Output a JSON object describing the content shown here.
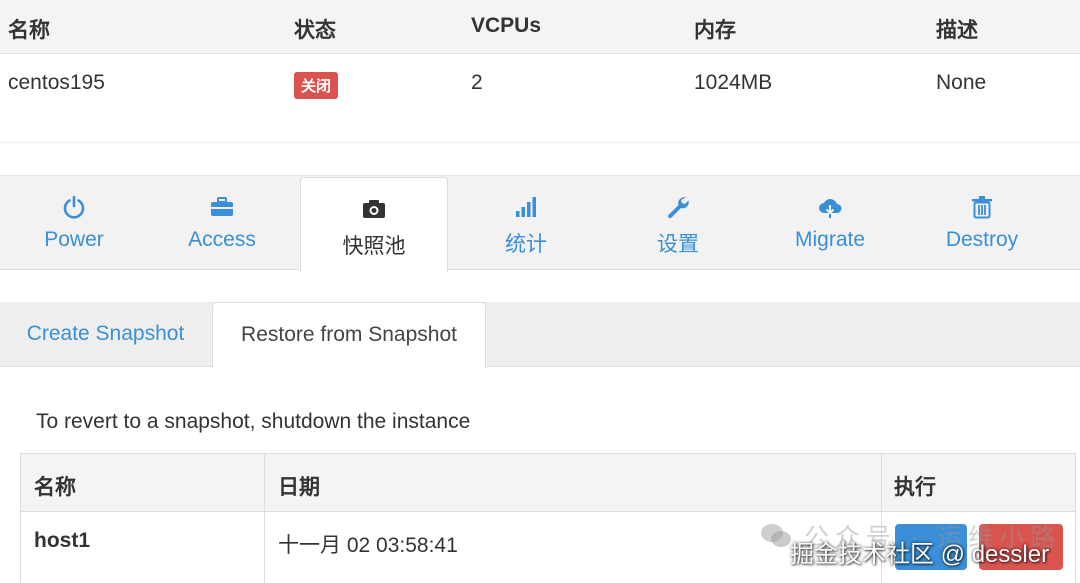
{
  "instance_table": {
    "headers": [
      "名称",
      "状态",
      "VCPUs",
      "内存",
      "描述"
    ],
    "row": {
      "name": "centos195",
      "status": "关闭",
      "vcpus": "2",
      "memory": "1024MB",
      "description": "None"
    }
  },
  "action_tabs": [
    {
      "label": "Power",
      "icon": "power-icon"
    },
    {
      "label": "Access",
      "icon": "briefcase-icon"
    },
    {
      "label": "快照池",
      "icon": "camera-icon",
      "active": true
    },
    {
      "label": "统计",
      "icon": "bar-chart-icon"
    },
    {
      "label": "设置",
      "icon": "wrench-icon"
    },
    {
      "label": "Migrate",
      "icon": "cloud-download-icon"
    },
    {
      "label": "Destroy",
      "icon": "trash-icon"
    }
  ],
  "snapshot_tabs": [
    {
      "label": "Create Snapshot"
    },
    {
      "label": "Restore from Snapshot",
      "active": true
    }
  ],
  "hint": "To revert to a snapshot, shutdown the instance",
  "snapshot_table": {
    "headers": [
      "名称",
      "日期",
      "执行"
    ],
    "rows": [
      {
        "name": "host1",
        "date": "十一月 02 03:58:41"
      }
    ]
  },
  "watermark": {
    "line1": "公众号 · 运维小路",
    "line2": "掘金技术社区 @ dessler"
  },
  "colors": {
    "accent": "#3a8fd8",
    "danger": "#d9534f",
    "header_bg": "#f4f4f4"
  }
}
